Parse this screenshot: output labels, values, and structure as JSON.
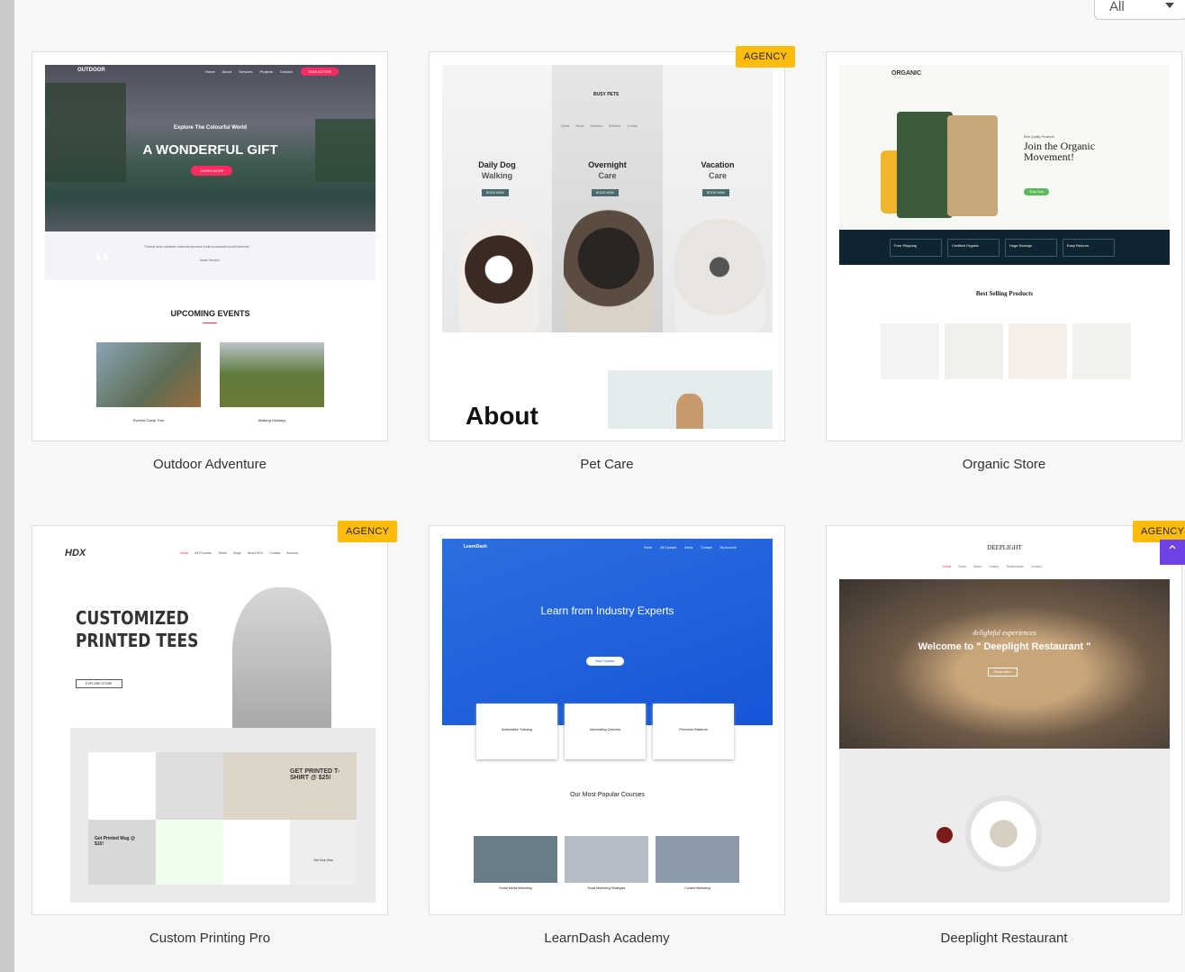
{
  "filter": {
    "selected": "All"
  },
  "badge_label": "AGENCY",
  "templates": [
    {
      "name": "Outdoor Adventure",
      "agency": false,
      "preview": {
        "logo": "OUTDOOR",
        "nav": [
          "Home",
          "About",
          "Services",
          "Projects",
          "Contact"
        ],
        "cta": "TAKE ACTION",
        "kicker": "Explore The Colourful World",
        "headline": "A WONDERFUL GIFT",
        "button": "LEARN MORE",
        "quote": "\"Faenat aedu carestem habentia spectent tonitrua mutastis locavit liberioris.\"",
        "author": "- Adam Sendler",
        "section": "UPCOMING EVENTS",
        "events": [
          "Everest Camp Trek",
          "Walking Holidays"
        ]
      }
    },
    {
      "name": "Pet Care",
      "agency": true,
      "preview": {
        "logo": "BUSY PETS",
        "nav": [
          "Home",
          "About",
          "Services",
          "Reviews",
          "Contact"
        ],
        "cols": [
          {
            "a": "Daily Dog",
            "b": "Walking"
          },
          {
            "a": "Overnight",
            "b": "Care"
          },
          {
            "a": "Vacation",
            "b": "Care"
          }
        ],
        "button": "BOOK NOW",
        "about": "About"
      }
    },
    {
      "name": "Organic Store",
      "agency": false,
      "preview": {
        "logo": "ORGANIC",
        "kicker": "Best Quality Products",
        "headline": "Join the Organic Movement!",
        "button": "Shop Now",
        "features": [
          "Free Shipping",
          "Certified Organic",
          "Huge Savings",
          "Easy Returns"
        ],
        "section": "Best Selling Products"
      }
    },
    {
      "name": "Custom Printing Pro",
      "agency": true,
      "preview": {
        "logo": "HDX",
        "nav": [
          "Home",
          "All Products",
          "Tshirts",
          "Mugs",
          "About HDX",
          "Contact",
          "Account"
        ],
        "headline1": "CUSTOMIZED",
        "headline2": "PRINTED TEES",
        "button": "EXPLORE STORE",
        "promo": "GET PRINTED T-SHIRT @ $25!",
        "mug": "Get Printed Mug @ $15!",
        "own": "Get Your Own"
      }
    },
    {
      "name": "LearnDash Academy",
      "agency": false,
      "preview": {
        "logo": "LearnDash",
        "nav": [
          "Home",
          "All Courses",
          "About",
          "Contact",
          "My Account"
        ],
        "headline": "Learn from Industry Experts",
        "button": "View Courses",
        "features": [
          "Actionable Training",
          "Interesting Quizzes",
          "Premium Material"
        ],
        "section": "Our Most Popular Courses",
        "courses": [
          "Social Media Marketing",
          "Email Marketing Strategies",
          "Content Marketing"
        ]
      }
    },
    {
      "name": "Deeplight Restaurant",
      "agency": true,
      "preview": {
        "logo": "DEEPLIGHT",
        "nav": [
          "Home",
          "News",
          "About",
          "Gallery",
          "Testimonials",
          "Contact"
        ],
        "kicker": "delightful experiences",
        "headline": "Welcome to \" Deeplight Restaurant \"",
        "button": "Reservation"
      }
    }
  ],
  "colors": {
    "accent": "#ff2a5f",
    "badge": "#ffbc0a",
    "scroll_top": "#6e42e4"
  }
}
